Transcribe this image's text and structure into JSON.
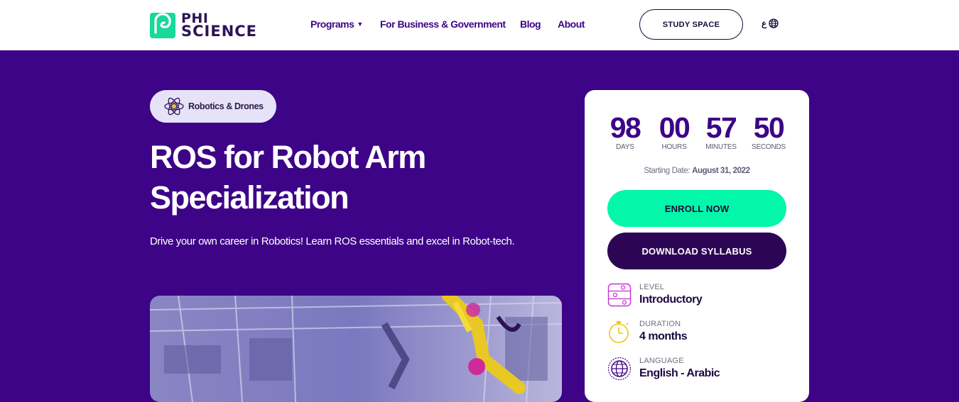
{
  "brand": {
    "line1": "PHI",
    "line2": "SCIENCE"
  },
  "nav": {
    "programs": "Programs",
    "business": "For Business & Government",
    "blog": "Blog",
    "about": "About",
    "study_space": "STUDY SPACE",
    "lang_glyph": "ع"
  },
  "hero": {
    "tag": "Robotics & Drones",
    "title_line1": "ROS for Robot Arm",
    "title_line2": "Specialization",
    "subtitle": "Drive your own career in Robotics! Learn ROS essentials and excel in Robot-tech."
  },
  "card": {
    "countdown": [
      {
        "value": "98",
        "label": "DAYS"
      },
      {
        "value": "00",
        "label": "HOURS"
      },
      {
        "value": "57",
        "label": "MINUTES"
      },
      {
        "value": "50",
        "label": "SECONDS"
      }
    ],
    "start_label": "Starting Date:",
    "start_date": "August 31, 2022",
    "enroll": "ENROLL NOW",
    "download": "DOWNLOAD SYLLABUS",
    "level_label": "LEVEL",
    "level_value": "Introductory",
    "duration_label": "DURATION",
    "duration_value": "4 months",
    "language_label": "LANGUAGE",
    "language_value": "English - Arabic"
  },
  "colors": {
    "brand_purple": "#3d0487",
    "accent_green": "#03f7a8",
    "dark_purple": "#2c0654",
    "logo_green": "#18d89a"
  }
}
